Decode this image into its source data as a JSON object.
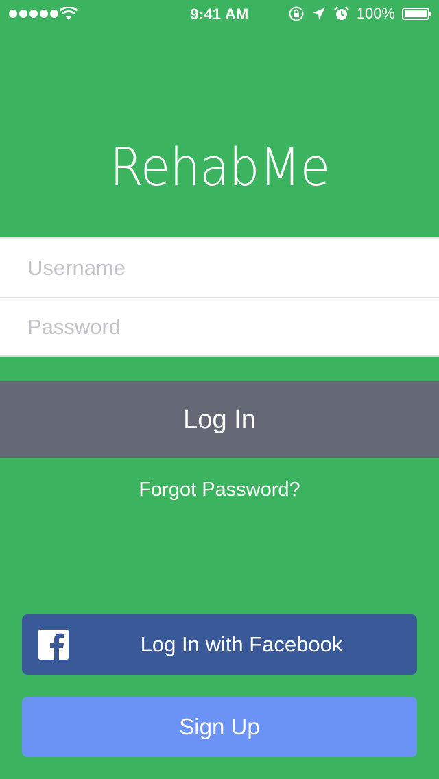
{
  "status_bar": {
    "time": "9:41 AM",
    "battery_percent": "100%",
    "signal_dots": 5,
    "icons": [
      "signal-dots",
      "wifi-icon",
      "rotation-lock-icon",
      "location-icon",
      "alarm-icon",
      "battery-icon"
    ]
  },
  "app": {
    "title": "RehabMe"
  },
  "form": {
    "username_placeholder": "Username",
    "password_placeholder": "Password"
  },
  "actions": {
    "login_label": "Log In",
    "forgot_label": "Forgot Password?",
    "facebook_label": "Log In with Facebook",
    "signup_label": "Sign Up"
  },
  "colors": {
    "background": "#3cb35e",
    "login_button": "#636874",
    "facebook_button": "#3a5998",
    "signup_button": "#6b93f5"
  }
}
